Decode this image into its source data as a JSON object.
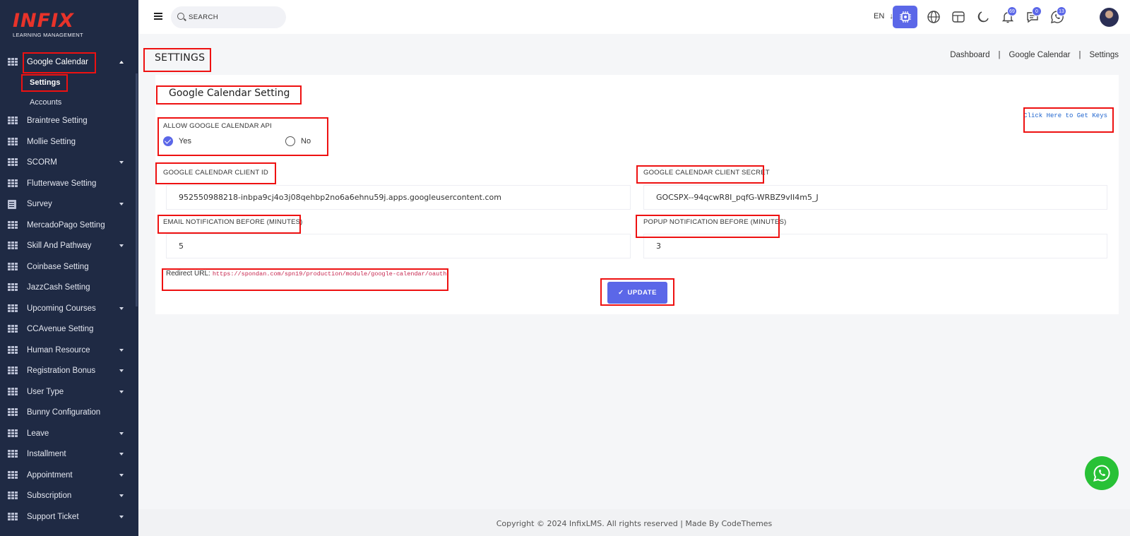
{
  "brand": {
    "logo_main": "INFIX",
    "logo_sub": "LEARNING MANAGEMENT"
  },
  "sidebar": {
    "active_group": {
      "label": "Google Calendar",
      "icon": "grid-icon"
    },
    "sub_items": [
      {
        "label": "Settings",
        "active": true
      },
      {
        "label": "Accounts",
        "active": false
      }
    ],
    "items": [
      {
        "label": "Braintree Setting",
        "icon": "grid-icon",
        "has_caret": false
      },
      {
        "label": "Mollie Setting",
        "icon": "grid-icon",
        "has_caret": false
      },
      {
        "label": "SCORM",
        "icon": "grid-icon",
        "has_caret": true
      },
      {
        "label": "Flutterwave Setting",
        "icon": "grid-icon",
        "has_caret": false
      },
      {
        "label": "Survey",
        "icon": "document-icon",
        "has_caret": true
      },
      {
        "label": "MercadoPago Setting",
        "icon": "grid-icon",
        "has_caret": false
      },
      {
        "label": "Skill And Pathway",
        "icon": "grid-icon",
        "has_caret": true
      },
      {
        "label": "Coinbase Setting",
        "icon": "grid-icon",
        "has_caret": false
      },
      {
        "label": "JazzCash Setting",
        "icon": "grid-icon",
        "has_caret": false
      },
      {
        "label": "Upcoming Courses",
        "icon": "grid-icon",
        "has_caret": true
      },
      {
        "label": "CCAvenue Setting",
        "icon": "grid-icon",
        "has_caret": false
      },
      {
        "label": "Human Resource",
        "icon": "grid-icon",
        "has_caret": true
      },
      {
        "label": "Registration Bonus",
        "icon": "grid-icon",
        "has_caret": true
      },
      {
        "label": "User Type",
        "icon": "grid-icon",
        "has_caret": true
      },
      {
        "label": "Bunny Configuration",
        "icon": "grid-icon",
        "has_caret": false
      },
      {
        "label": "Leave",
        "icon": "grid-icon",
        "has_caret": true
      },
      {
        "label": "Installment",
        "icon": "grid-icon",
        "has_caret": true
      },
      {
        "label": "Appointment",
        "icon": "grid-icon",
        "has_caret": true
      },
      {
        "label": "Subscription",
        "icon": "grid-icon",
        "has_caret": true
      },
      {
        "label": "Support Ticket",
        "icon": "grid-icon",
        "has_caret": true
      }
    ]
  },
  "topbar": {
    "search_placeholder": "SEARCH",
    "language": "EN",
    "icons": [
      "menu-icon",
      "search-icon",
      "chip-icon",
      "globe-icon",
      "layout-icon",
      "moon-icon",
      "bell-icon",
      "chat-icon",
      "whatsapp-icon"
    ],
    "notifications_count": "69",
    "messages_count": "0",
    "whatsapp_count": "13"
  },
  "page": {
    "title": "SETTINGS",
    "breadcrumb": [
      "Dashboard",
      "Google Calendar",
      "Settings"
    ]
  },
  "form": {
    "title": "Google Calendar Setting",
    "get_keys_link": "Click Here to Get Keys",
    "allow_api_label": "ALLOW GOOGLE CALENDAR API",
    "option_yes": "Yes",
    "option_no": "No",
    "selected_option": "Yes",
    "client_id_label": "GOOGLE CALENDAR CLIENT ID",
    "client_id_value": "952550988218-inbpa9cj4o3j08qehbp2no6a6ehnu59j.apps.googleusercontent.com",
    "client_secret_label": "GOOGLE CALENDAR CLIENT SECRET",
    "client_secret_value": "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",
    "email_notify_label": "EMAIL NOTIFICATION BEFORE (MINUTES)",
    "email_notify_value": "5",
    "popup_notify_label": "POPUP NOTIFICATION BEFORE (MINUTES)",
    "popup_notify_value": "3",
    "redirect_label": "Redirect URL:",
    "redirect_url": "https://spondan.com/spn19/production/module/google-calendar/oauth",
    "update_label": "UPDATE"
  },
  "footer": {
    "text": "Copyright © 2024 InfixLMS. All rights reserved | Made By CodeThemes"
  },
  "colors": {
    "accent": "#5b67e8",
    "sidebar_bg": "#1f2a44",
    "logo_red": "#e8332a",
    "annotation_red": "#ee1111",
    "whatsapp_green": "#28c136"
  }
}
